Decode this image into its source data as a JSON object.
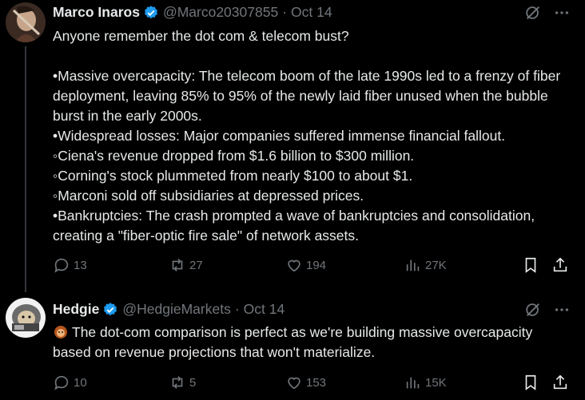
{
  "posts": [
    {
      "author": {
        "name": "Marco Inaros",
        "handle": "@Marco20307855",
        "date": "Oct 14"
      },
      "lines": [
        "Anyone remember the dot com & telecom bust?",
        "",
        "•Massive overcapacity: The telecom boom of the late 1990s led to a frenzy of fiber deployment, leaving 85% to 95% of the newly laid fiber unused when the bubble burst in the early 2000s.",
        "•Widespread losses: Major companies suffered immense financial fallout.",
        "◦Ciena's revenue dropped from $1.6 billion to $300 million.",
        "◦Corning's stock plummeted from nearly $100 to about $1.",
        "◦Marconi sold off subsidiaries at depressed prices.",
        "•Bankruptcies: The crash prompted a wave of bankruptcies and consolidation, creating a \"fiber-optic fire sale\" of network assets."
      ],
      "stats": {
        "replies": "13",
        "reposts": "27",
        "likes": "194",
        "views": "27K"
      }
    },
    {
      "author": {
        "name": "Hedgie",
        "handle": "@HedgieMarkets",
        "date": "Oct 14"
      },
      "text": "The dot-com comparison is perfect as we're building massive overcapacity based on revenue projections that won't materialize.",
      "stats": {
        "replies": "10",
        "reposts": "5",
        "likes": "153",
        "views": "15K"
      }
    }
  ],
  "icons": {
    "verified": "verified-badge-icon",
    "grok": "grok-icon",
    "more": "more-icon",
    "reply": "reply-icon",
    "repost": "repost-icon",
    "like": "like-icon",
    "views": "views-icon",
    "bookmark": "bookmark-icon",
    "share": "share-icon",
    "emoji": "hedgehog-emoji"
  },
  "colors": {
    "background": "#000000",
    "text": "#e7e9ea",
    "muted": "#71767b",
    "verified": "#1d9bf0"
  }
}
